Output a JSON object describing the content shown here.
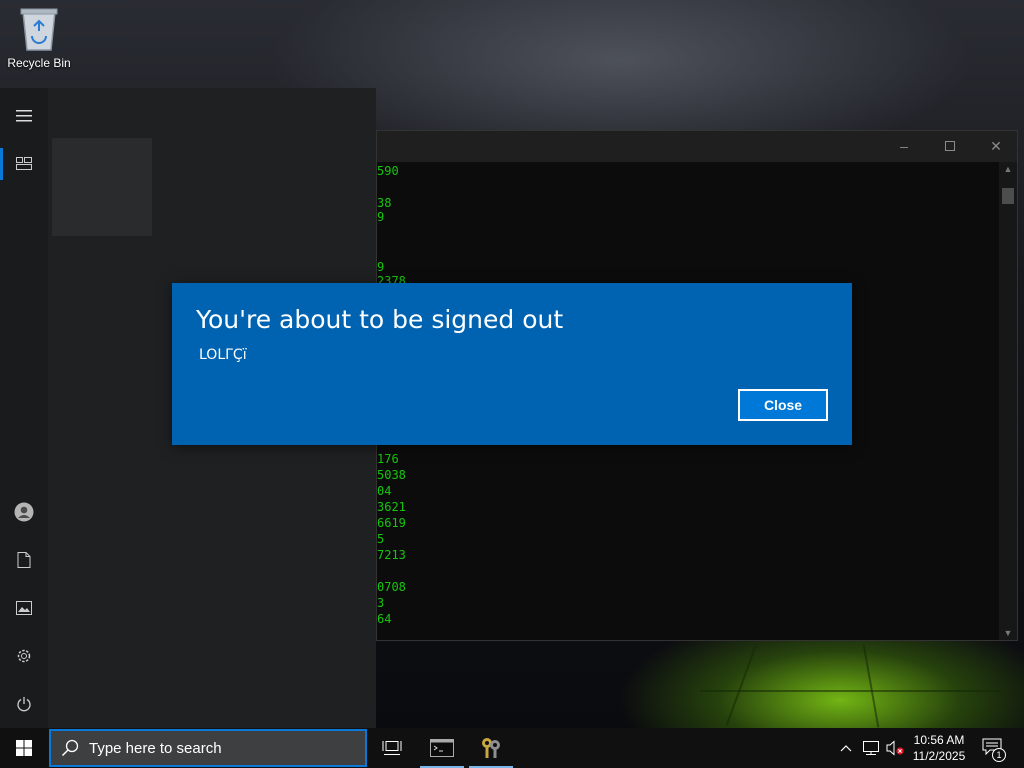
{
  "desktop": {
    "recycle_bin_label": "Recycle Bin"
  },
  "console": {
    "lines": [
      "590",
      "38",
      "9",
      "9",
      "2378",
      "176",
      "5038",
      "04",
      "3621",
      "6619",
      "5",
      "7213",
      "0708",
      "3",
      "64"
    ],
    "icons": {
      "minimize": "minimize-icon",
      "maximize": "maximize-icon",
      "close": "close-icon"
    }
  },
  "start_menu": {
    "rail_icons": [
      "hamburger-icon",
      "tiles-icon",
      "user-icon",
      "document-icon",
      "pictures-icon",
      "settings-icon",
      "power-icon"
    ]
  },
  "dialog": {
    "title": "You're about to be signed out",
    "subtitle": "LOLΓÇï",
    "close_label": "Close",
    "colors": {
      "background": "#0063b1",
      "button": "#0078d7"
    }
  },
  "taskbar": {
    "search_placeholder": "Type here to search",
    "time": "10:56 AM",
    "date": "11/2/2025",
    "notification_count": "1",
    "apps": [
      "task-view-icon",
      "console-app-icon",
      "keys-app-icon"
    ],
    "tray_icons": [
      "chevron-up-icon",
      "network-icon",
      "volume-muted-icon"
    ],
    "accent": "#0a78d7"
  }
}
